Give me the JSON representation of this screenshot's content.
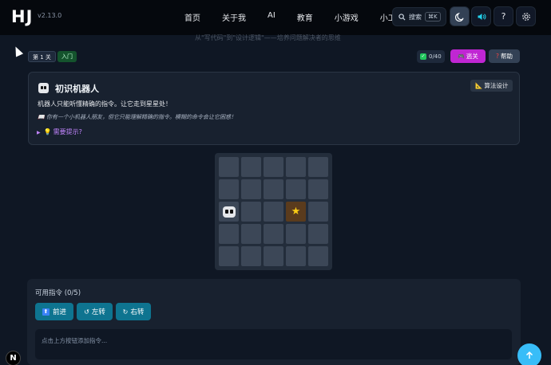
{
  "app": {
    "logo": "HJ",
    "version": "v2.13.0"
  },
  "nav": [
    {
      "label": "首页"
    },
    {
      "label": "关于我"
    },
    {
      "label": "AI"
    },
    {
      "label": "教育"
    },
    {
      "label": "小游戏"
    },
    {
      "label": "小工具"
    }
  ],
  "search": {
    "label": "搜索",
    "shortcut": "⌘K"
  },
  "page_subtitle": "从\"写代码\"到\"设计逻辑\"——培养问题解决者的思维",
  "level": {
    "number_label": "第 1 关",
    "difficulty": "入门",
    "progress": "0/40",
    "skip_label": "逃关",
    "help_label": "帮助"
  },
  "card": {
    "title": "初识机器人",
    "description": "机器人只能听懂精确的指令。让它走到星星处！",
    "story": "📖 你有一个小机器人朋友，但它只能理解精确的指令。模糊的命令会让它困惑！",
    "hint_label": "需要提示?",
    "algo_label": "算法设计"
  },
  "grid": {
    "rows": 5,
    "cols": 5,
    "robot": [
      2,
      0
    ],
    "goal": [
      2,
      3
    ],
    "goal_symbol": "★"
  },
  "commands": {
    "title": "可用指令 (0/5)",
    "forward": "前进",
    "left": "左转",
    "right": "右转",
    "placeholder": "点击上方按钮添加指令..."
  },
  "colors": {
    "accent": "#0e7490",
    "skip": "#c026d3",
    "fab": "#38bdf8",
    "star": "#facc15"
  },
  "icons": {
    "search": "search-icon",
    "moon": "moon-icon",
    "sound": "speaker-icon",
    "help": "question-icon",
    "settings": "gear-icon",
    "scroll_top": "arrow-up-icon"
  }
}
